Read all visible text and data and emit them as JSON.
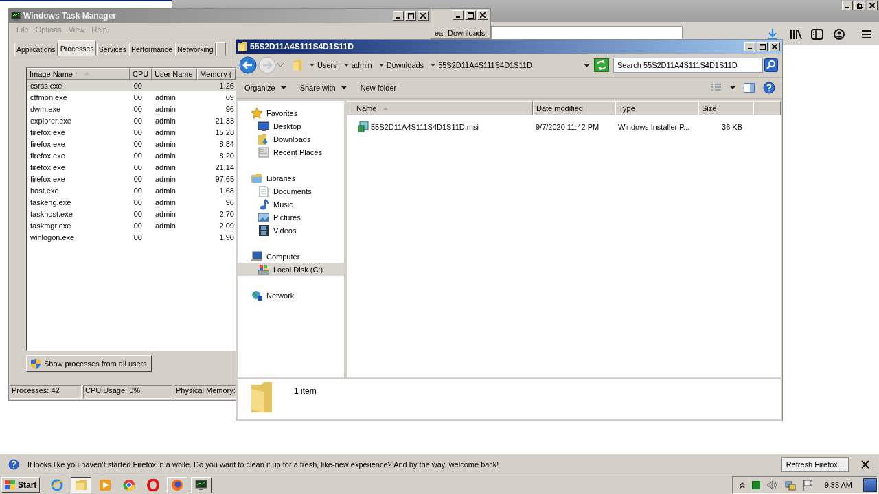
{
  "back_window": {
    "title_fragment": "ear Downloads"
  },
  "task_manager": {
    "title": "Windows Task Manager",
    "menu": [
      "File",
      "Options",
      "View",
      "Help"
    ],
    "tabs": [
      {
        "label": "Applications",
        "selected": false
      },
      {
        "label": "Processes",
        "selected": true
      },
      {
        "label": "Services",
        "selected": false
      },
      {
        "label": "Performance",
        "selected": false
      },
      {
        "label": "Networking",
        "selected": false
      }
    ],
    "columns": [
      "Image Name",
      "CPU",
      "User Name",
      "Memory ("
    ],
    "rows": [
      {
        "image_name": "csrss.exe",
        "cpu": "00",
        "user_name": "",
        "memory": "1,26",
        "selected": true
      },
      {
        "image_name": "ctfmon.exe",
        "cpu": "00",
        "user_name": "admin",
        "memory": "69",
        "selected": false
      },
      {
        "image_name": "dwm.exe",
        "cpu": "00",
        "user_name": "admin",
        "memory": "96",
        "selected": false
      },
      {
        "image_name": "explorer.exe",
        "cpu": "00",
        "user_name": "admin",
        "memory": "21,33",
        "selected": false
      },
      {
        "image_name": "firefox.exe",
        "cpu": "00",
        "user_name": "admin",
        "memory": "15,28",
        "selected": false
      },
      {
        "image_name": "firefox.exe",
        "cpu": "00",
        "user_name": "admin",
        "memory": "8,84",
        "selected": false
      },
      {
        "image_name": "firefox.exe",
        "cpu": "00",
        "user_name": "admin",
        "memory": "8,20",
        "selected": false
      },
      {
        "image_name": "firefox.exe",
        "cpu": "00",
        "user_name": "admin",
        "memory": "21,14",
        "selected": false
      },
      {
        "image_name": "firefox.exe",
        "cpu": "00",
        "user_name": "admin",
        "memory": "97,65",
        "selected": false
      },
      {
        "image_name": "host.exe",
        "cpu": "00",
        "user_name": "admin",
        "memory": "1,68",
        "selected": false
      },
      {
        "image_name": "taskeng.exe",
        "cpu": "00",
        "user_name": "admin",
        "memory": "96",
        "selected": false
      },
      {
        "image_name": "taskhost.exe",
        "cpu": "00",
        "user_name": "admin",
        "memory": "2,70",
        "selected": false
      },
      {
        "image_name": "taskmgr.exe",
        "cpu": "00",
        "user_name": "admin",
        "memory": "2,09",
        "selected": false
      },
      {
        "image_name": "winlogon.exe",
        "cpu": "00",
        "user_name": "",
        "memory": "1,90",
        "selected": false
      }
    ],
    "button": "Show processes from all users",
    "status_bar": [
      "Processes: 42",
      "CPU Usage: 0%",
      "Physical Memory:"
    ]
  },
  "explorer": {
    "title": "55S2D11A4S111S4D1S11D",
    "breadcrumbs": [
      "Users",
      "admin",
      "Downloads",
      "55S2D11A4S111S4D1S11D"
    ],
    "search": {
      "placeholder": "Search 55S2D11A4S111S4D1S11D"
    },
    "toolbar": [
      {
        "label": "Organize",
        "has_menu": true
      },
      {
        "label": "Share with",
        "has_menu": true
      },
      {
        "label": "New folder",
        "has_menu": false
      }
    ],
    "nav": [
      {
        "label": "Favorites",
        "kind": "star",
        "selected": false,
        "children": [
          {
            "label": "Desktop",
            "kind": "desktop",
            "selected": false
          },
          {
            "label": "Downloads",
            "kind": "downloads",
            "selected": false
          },
          {
            "label": "Recent Places",
            "kind": "recent",
            "selected": false
          }
        ]
      },
      {
        "label": "Libraries",
        "kind": "library",
        "selected": false,
        "children": [
          {
            "label": "Documents",
            "kind": "document",
            "selected": false
          },
          {
            "label": "Music",
            "kind": "music",
            "selected": false
          },
          {
            "label": "Pictures",
            "kind": "pictures",
            "selected": false
          },
          {
            "label": "Videos",
            "kind": "videos",
            "selected": false
          }
        ]
      },
      {
        "label": "Computer",
        "kind": "computer",
        "selected": false,
        "children": [
          {
            "label": "Local Disk (C:)",
            "kind": "disk",
            "selected": true
          }
        ]
      },
      {
        "label": "Network",
        "kind": "network",
        "selected": false
      }
    ],
    "columns": [
      "Name",
      "Date modified",
      "Type",
      "Size"
    ],
    "files": [
      {
        "name": "55S2D11A4S111S4D1S11D.msi",
        "date_modified": "9/7/2020 11:42 PM",
        "type": "Windows Installer P...",
        "size": "36 KB",
        "selected": false
      }
    ],
    "details": "1 item"
  },
  "notification": {
    "message": "It looks like you haven’t started Firefox in a while. Do you want to clean it up for a fresh, like-new experience? And by the way, welcome back!",
    "button": "Refresh Firefox..."
  },
  "taskbar": {
    "start": "Start",
    "apps": [
      {
        "kind": "ie",
        "open": false,
        "selected": false
      },
      {
        "kind": "folder",
        "open": true,
        "selected": true
      },
      {
        "kind": "media",
        "open": false,
        "selected": false
      },
      {
        "kind": "chrome",
        "open": false,
        "selected": false
      },
      {
        "kind": "opera",
        "open": false,
        "selected": false
      },
      {
        "kind": "firefox",
        "open": true,
        "selected": false
      },
      {
        "kind": "monitor",
        "open": true,
        "selected": false
      }
    ],
    "clock": "9:33 AM"
  }
}
